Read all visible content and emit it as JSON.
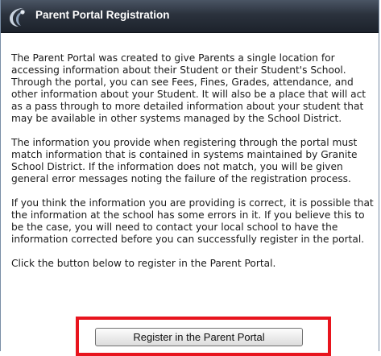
{
  "header": {
    "title": "Parent Portal Registration",
    "logo_icon": "school-district-logo-icon"
  },
  "content": {
    "paragraphs": [
      "The Parent Portal was created to give Parents a single location for accessing information about their Student or their Student's School. Through the portal, you can see Fees, Fines, Grades, attendance, and other information about your Student. It will also be a place that will act as a pass through to more detailed information about your student that may be available in other systems managed by the School District.",
      "The information you provide when registering through the portal must match information that is contained in systems maintained by Granite School District. If the information does not match, you will be given general error messages noting the failure of the registration process.",
      "If you think the information you are providing is correct, it is possible that the information at the school has some errors in it. If you believe this to be the case, you will need to contact your local school to have the information corrected before you can successfully register in the portal.",
      "Click the button below to register in the Parent Portal."
    ]
  },
  "actions": {
    "register_label": "Register in the Parent Portal"
  },
  "colors": {
    "titlebar": "#2b323d",
    "highlight": "#e8141d",
    "text": "#1a1a1a"
  }
}
